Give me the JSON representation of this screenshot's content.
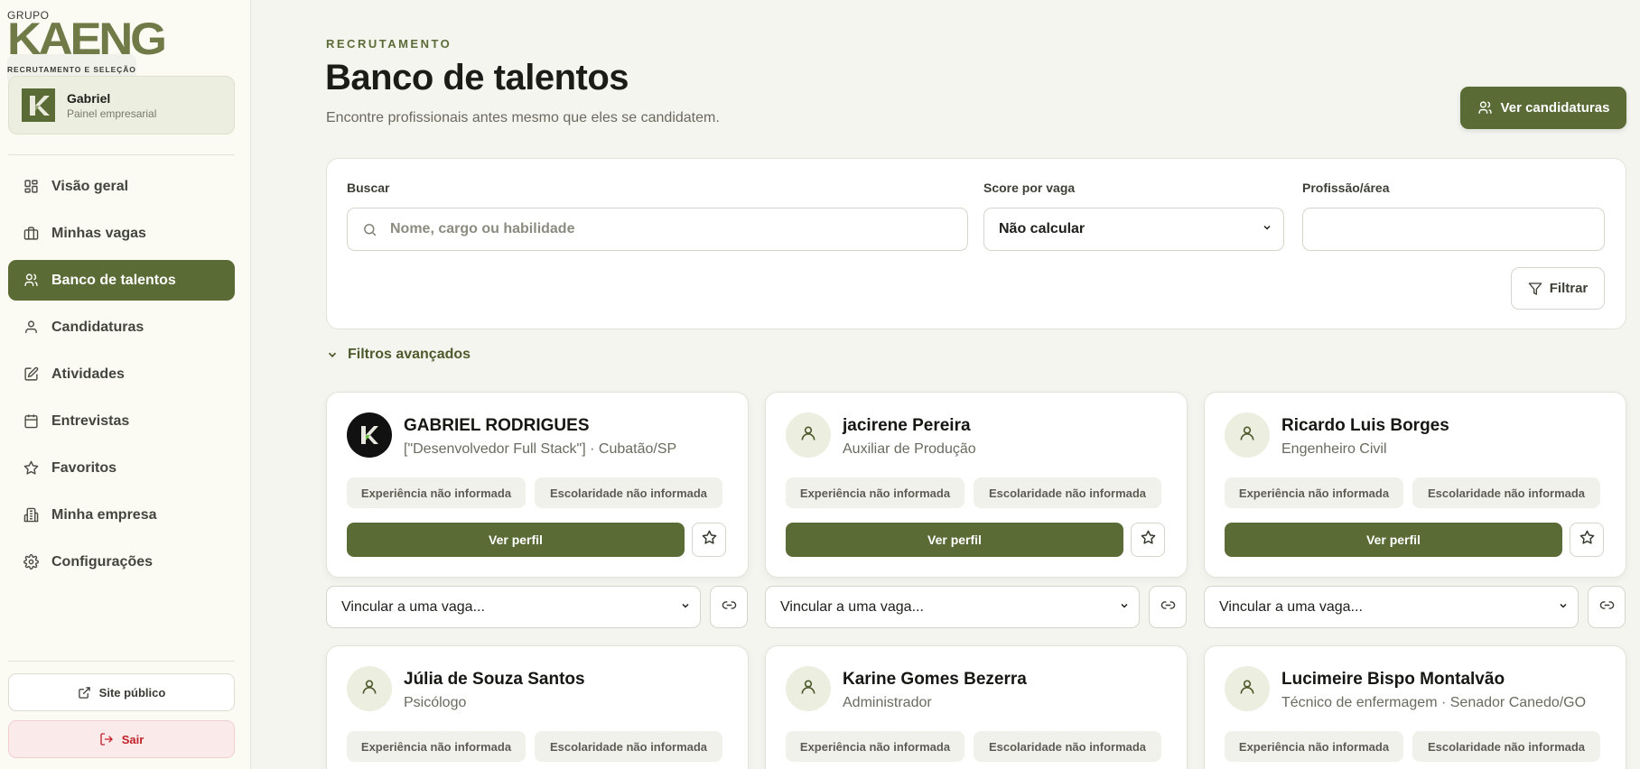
{
  "brand": {
    "grupo": "GRUPO",
    "name": "KAENG",
    "tagline": "RECRUTAMENTO E SELEÇÃO",
    "accent": "#5b6b36"
  },
  "user": {
    "name": "Gabriel",
    "role": "Painel empresarial"
  },
  "nav": [
    {
      "label": "Visão geral",
      "icon": "grid-icon",
      "active": false
    },
    {
      "label": "Minhas vagas",
      "icon": "briefcase-icon",
      "active": false
    },
    {
      "label": "Banco de talentos",
      "icon": "users-icon",
      "active": true
    },
    {
      "label": "Candidaturas",
      "icon": "user-icon",
      "active": false
    },
    {
      "label": "Atividades",
      "icon": "edit-icon",
      "active": false
    },
    {
      "label": "Entrevistas",
      "icon": "calendar-icon",
      "active": false
    },
    {
      "label": "Favoritos",
      "icon": "star-icon",
      "active": false
    },
    {
      "label": "Minha empresa",
      "icon": "building-icon",
      "active": false
    },
    {
      "label": "Configurações",
      "icon": "gear-icon",
      "active": false
    }
  ],
  "footer": {
    "site_label": "Site público",
    "logout_label": "Sair"
  },
  "header": {
    "eyebrow": "RECRUTAMENTO",
    "title": "Banco de talentos",
    "subtitle": "Encontre profissionais antes mesmo que eles se candidatem.",
    "action_label": "Ver candidaturas"
  },
  "filters": {
    "search_label": "Buscar",
    "search_placeholder": "Nome, cargo ou habilidade",
    "search_value": "",
    "score_label": "Score por vaga",
    "score_value": "Não calcular",
    "area_label": "Profissão/área",
    "area_value": "",
    "filter_button": "Filtrar",
    "advanced_label": "Filtros avançados"
  },
  "card_labels": {
    "view_profile": "Ver perfil",
    "link_placeholder": "Vincular a uma vaga..."
  },
  "candidates": [
    {
      "name": "GABRIEL RODRIGUES",
      "info": "[\"Desenvolvedor Full Stack\"] · Cubatão/SP",
      "experience": "Experiência não informada",
      "education": "Escolaridade não informada",
      "avatar": "logo"
    },
    {
      "name": "jacirene Pereira",
      "info": "Auxiliar de Produção",
      "experience": "Experiência não informada",
      "education": "Escolaridade não informada",
      "avatar": "user-icon"
    },
    {
      "name": "Ricardo Luis Borges",
      "info": "Engenheiro Civil",
      "experience": "Experiência não informada",
      "education": "Escolaridade não informada",
      "avatar": "user-icon"
    },
    {
      "name": "Júlia de Souza Santos",
      "info": "Psicólogo",
      "experience": "Experiência não informada",
      "education": "Escolaridade não informada",
      "avatar": "user-icon"
    },
    {
      "name": "Karine Gomes Bezerra",
      "info": "Administrador",
      "experience": "Experiência não informada",
      "education": "Escolaridade não informada",
      "avatar": "user-icon"
    },
    {
      "name": "Lucimeire Bispo Montalvão",
      "info": "Técnico de enfermagem · Senador Canedo/GO",
      "experience": "Experiência não informada",
      "education": "Escolaridade não informada",
      "avatar": "user-icon"
    }
  ]
}
